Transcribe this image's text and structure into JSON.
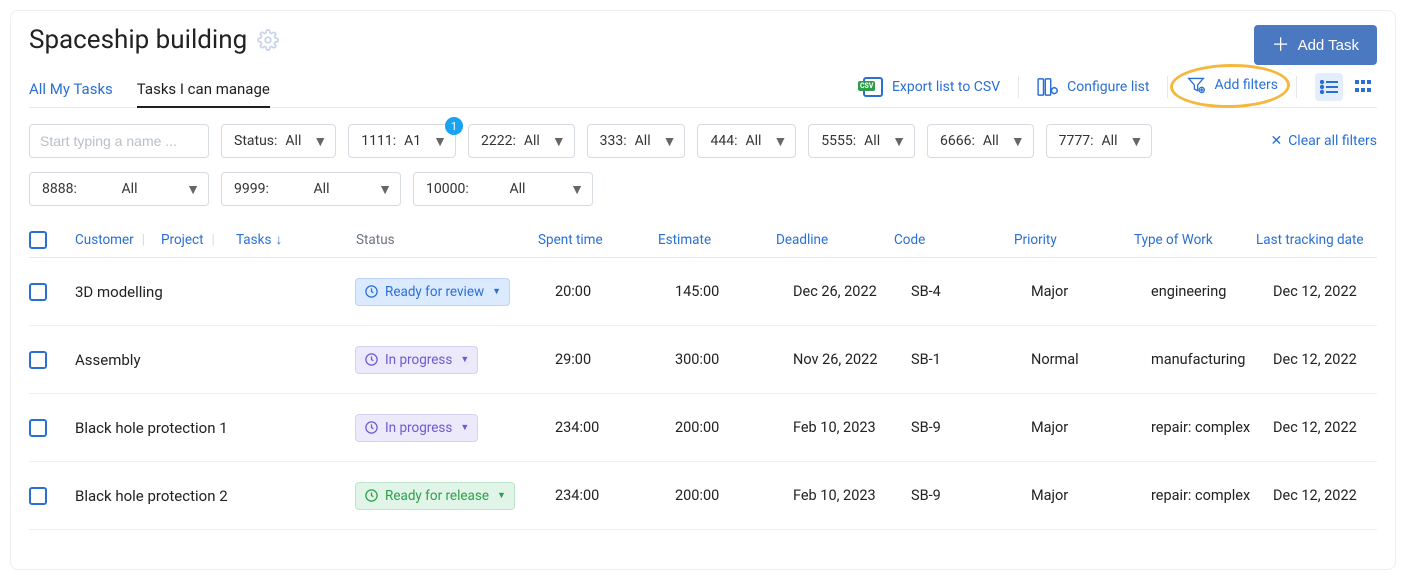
{
  "header": {
    "title": "Spaceship building",
    "add_task_label": "Add Task"
  },
  "tabs": [
    {
      "label": "All My Tasks",
      "active": false
    },
    {
      "label": "Tasks I can manage",
      "active": true
    }
  ],
  "toolbar": {
    "export_csv_label": "Export list to CSV",
    "configure_label": "Configure list",
    "add_filters_label": "Add filters"
  },
  "search": {
    "placeholder": "Start typing a name ..."
  },
  "filters_row1": [
    {
      "label": "Status:",
      "value": "All",
      "badge": null
    },
    {
      "label": "1111:",
      "value": "A1",
      "badge": "1"
    },
    {
      "label": "2222:",
      "value": "All",
      "badge": null
    },
    {
      "label": "333:",
      "value": "All",
      "badge": null
    },
    {
      "label": "444:",
      "value": "All",
      "badge": null
    },
    {
      "label": "5555:",
      "value": "All",
      "badge": null
    },
    {
      "label": "6666:",
      "value": "All",
      "badge": null
    },
    {
      "label": "7777:",
      "value": "All",
      "badge": null
    }
  ],
  "filters_row2": [
    {
      "label": "8888:",
      "value": "All"
    },
    {
      "label": "9999:",
      "value": "All"
    },
    {
      "label": "10000:",
      "value": "All"
    }
  ],
  "clear_all_label": "Clear all filters",
  "columns": {
    "customer": "Customer",
    "project": "Project",
    "tasks": "Tasks",
    "status": "Status",
    "spent": "Spent time",
    "estimate": "Estimate",
    "deadline": "Deadline",
    "code": "Code",
    "priority": "Priority",
    "type": "Type of Work",
    "tracking": "Last tracking date"
  },
  "rows": [
    {
      "name": "3D modelling",
      "status_kind": "review",
      "status": "Ready for review",
      "spent": "20:00",
      "estimate": "145:00",
      "deadline": "Dec 26, 2022",
      "deadline_warn": false,
      "code": "SB-4",
      "priority": "Major",
      "type": "engineering",
      "tracking": "Dec 12, 2022"
    },
    {
      "name": "Assembly",
      "status_kind": "progress",
      "status": "In progress",
      "spent": "29:00",
      "estimate": "300:00",
      "deadline": "Nov 26, 2022",
      "deadline_warn": true,
      "code": "SB-1",
      "priority": "Normal",
      "type": "manufacturing",
      "tracking": "Dec 12, 2022"
    },
    {
      "name": "Black hole protection 1",
      "status_kind": "progress",
      "status": "In progress",
      "spent": "234:00",
      "estimate": "200:00",
      "deadline": "Feb 10, 2023",
      "deadline_warn": false,
      "code": "SB-9",
      "priority": "Major",
      "type": "repair: complex",
      "tracking": "Dec 12, 2022"
    },
    {
      "name": "Black hole protection 2",
      "status_kind": "release",
      "status": "Ready for release",
      "spent": "234:00",
      "estimate": "200:00",
      "deadline": "Feb 10, 2023",
      "deadline_warn": false,
      "code": "SB-9",
      "priority": "Major",
      "type": "repair: complex",
      "tracking": "Dec 12, 2022"
    }
  ]
}
